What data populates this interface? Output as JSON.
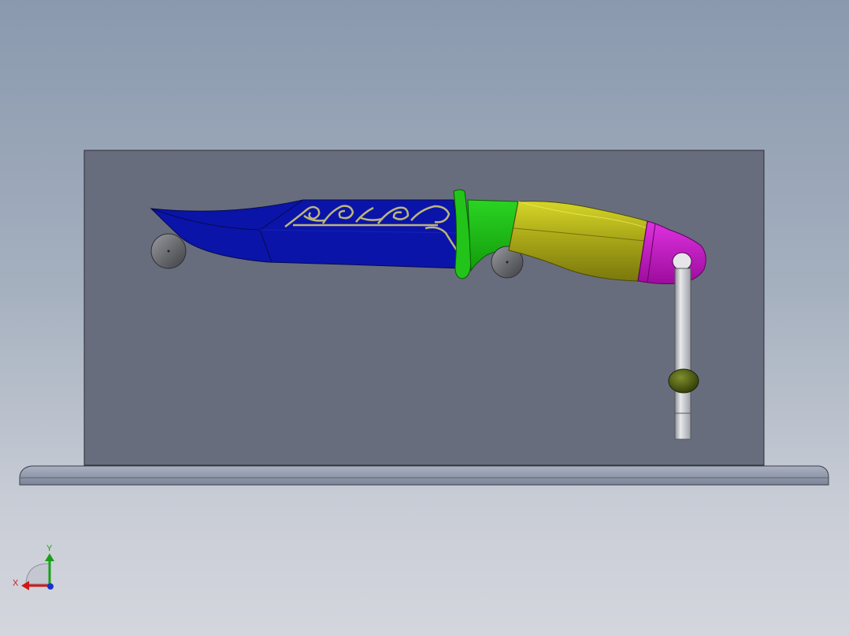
{
  "viewport": {
    "background_top": "#8a99ae",
    "background_bottom": "#d3d6dd"
  },
  "model": {
    "display_panel_color": "#686d7d",
    "base_plate_color": "#8e96aa",
    "blade_color": "#0b14a8",
    "engraving_color": "#bcb57a",
    "guard_color": "#22c41a",
    "bolster_color": "#1fb516",
    "handle_color": "#a8a818",
    "pommel_color": "#c81cc8",
    "stand_rod_color": "#c6c8cc",
    "stand_bead_color": "#4a5a0c",
    "support_ball_color": "#6a6c70"
  },
  "triad": {
    "x_label": "X",
    "y_label": "Y",
    "x_color": "#d01818",
    "y_color": "#18a018",
    "z_color": "#1830d0"
  }
}
